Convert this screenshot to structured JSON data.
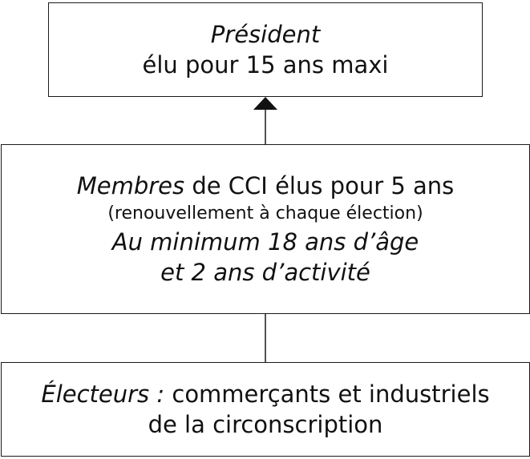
{
  "president": {
    "title": "Président",
    "subtitle": "élu pour 15 ans maxi"
  },
  "membres": {
    "title": "Membres",
    "title_rest": " de CCI élus pour 5 ans",
    "note": "(renouvellement à chaque élection)",
    "cond1": "Au minimum 18 ans d’âge",
    "cond2": "et 2 ans d’activité"
  },
  "electeurs": {
    "title": "Électeurs :",
    "title_rest": " commerçants et industriels",
    "line2": "de la circonscription"
  }
}
